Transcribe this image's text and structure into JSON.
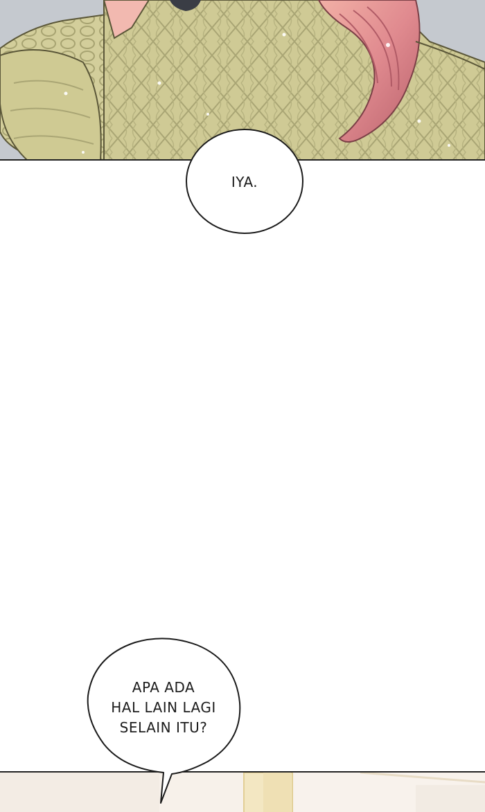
{
  "panels": {
    "top": {
      "description_colors": {
        "sweater": "#c9c48f",
        "sweater_shadow": "#9e9a6a",
        "hair": "#e89b9b",
        "hair_dark": "#c46f73",
        "skin": "#f4c9b8",
        "bg_gray": "#c9cdd3"
      }
    },
    "bottom": {
      "colors": {
        "wall": "#f5eee6",
        "frame": "#e8d9a8",
        "bg": "#faf6f0"
      }
    }
  },
  "bubbles": {
    "first": {
      "text": "IYA."
    },
    "second": {
      "lines": [
        "APA ADA",
        "HAL LAIN LAGI",
        "SELAIN ITU?"
      ]
    }
  }
}
